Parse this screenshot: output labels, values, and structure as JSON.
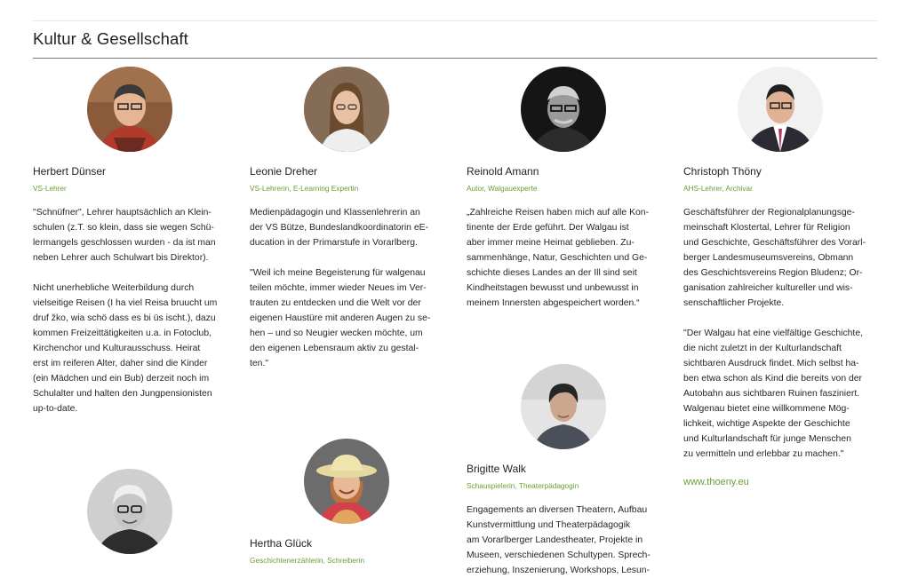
{
  "section": {
    "title": "Kultur & Gesellschaft"
  },
  "people": [
    {
      "name": "Herbert Dünser",
      "role": "VS-Lehrer",
      "bio": [
        "\"Schnüfner\", Lehrer hauptsächlich an Klein-\nschulen (z.T. so klein, dass sie wegen Schü-\nlermangels geschlossen wurden - da ist man\nneben Lehrer auch Schulwart bis Direktor).",
        "Nicht unerhebliche Weiterbildung durch\nvielseitige Reisen (I ha viel Reisa bruucht um\ndruf žko, wia schö dass es bi üs ischt.), dazu\nkommen Freizeittätigkeiten u.a. in Fotoclub,\nKirchenchor und Kulturausschuss. Heirat\nerst im reiferen Alter, daher sind die Kinder\n(ein Mädchen und ein Bub) derzeit noch im\nSchulalter und halten den Jungpensionisten\nup-to-date."
      ]
    },
    {
      "name": "Leonie Dreher",
      "role": "VS-Lehrerin, E-Learning Expertin",
      "bio": [
        "Medienpädagogin und Klassenlehrerin an\nder VS Bütze, Bundeslandkoordinatorin eE-\nducation in der Primarstufe in Vorarlberg.",
        "\"Weil ich meine Begeisterung für walgenau\nteilen möchte, immer wieder Neues im Ver-\ntrauten zu entdecken und die Welt vor der\neigenen Haustüre mit anderen Augen zu se-\nhen – und so Neugier wecken möchte, um\nden eigenen Lebensraum aktiv zu gestal-\nten.\""
      ]
    },
    {
      "name": "Reinold Amann",
      "role": "Autor, Walgauexperte",
      "bio": [
        "„Zahlreiche Reisen haben mich auf alle Kon-\ntinente der Erde geführt. Der Walgau ist\naber immer meine Heimat geblieben. Zu-\nsammenhänge, Natur, Geschichten und Ge-\nschichte dieses Landes  an der Ill  sind seit\nKindheitstagen bewusst und unbewusst in\nmeinem Innersten abgespeichert worden.“"
      ]
    },
    {
      "name": "Christoph Thöny",
      "role": "AHS-Lehrer, Archivar",
      "bio": [
        "Geschäftsführer der Regionalplanungsge-\nmeinschaft Klostertal, Lehrer für Religion\nund Geschichte, Geschäftsführer des Vorarl-\nberger Landesmuseumsvereins, Obmann\ndes Geschichtsvereins Region Bludenz; Or-\nganisation zahlreicher kultureller und wis-\nsenschaftlicher Projekte.",
        "\"Der Walgau hat eine vielfältige Geschichte,\ndie nicht zuletzt in der Kulturlandschaft\nsichtbaren Ausdruck findet. Mich selbst ha-\nben etwa schon als Kind die bereits von der\nAutobahn aus sichtbaren Ruinen fasziniert.\nWalgenau bietet eine willkommene Mög-\nlichkeit, wichtige Aspekte der Geschichte\nund Kulturlandschaft für junge Menschen\nzu vermitteln und erlebbar zu machen.\""
      ],
      "link": "www.thoeny.eu"
    },
    {
      "name": "Brigitte Walk",
      "role": "Schauspielerin, Theaterpädagogin",
      "bio": [
        "Engagements an diversen Theatern, Aufbau\nKunstvermittlung und Theaterpädagogik\nam Vorarlberger Landestheater, Projekte in\nMuseen, verschiedenen Schultypen. Sprech-\nerziehung, Inszenierung, Workshops, Lesun-"
      ]
    },
    {
      "name": "Hertha Glück",
      "role": "Geschichtenerzählerin, Schreiberin",
      "bio": []
    }
  ],
  "colors": {
    "accent": "#6a9e35",
    "rule": "#7a7a7a"
  }
}
